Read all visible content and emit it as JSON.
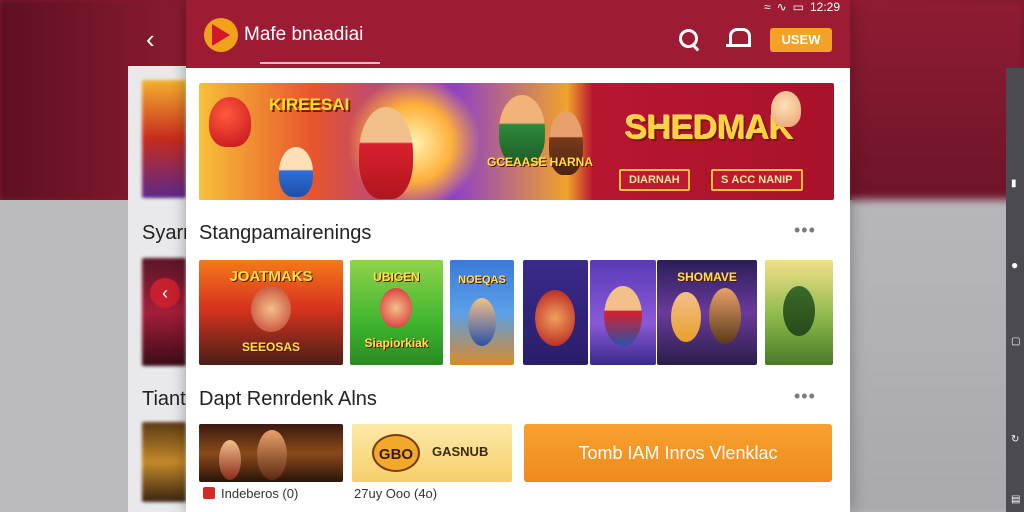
{
  "status_bar": {
    "time": "12:29"
  },
  "header": {
    "app_title": "Mafe bnaadiai",
    "action_button": "USEW"
  },
  "background": {
    "section_one_title": "Syarr",
    "section_two_title": "Tiant"
  },
  "hero": {
    "left_title": "KIREESAI",
    "sub_title": "GCEAASE HARNA",
    "main_title": "SHEDMAK",
    "button_left": "DIARNAH",
    "button_right": "S ACC NANIP"
  },
  "sections": [
    {
      "title": "Stangpamairenings",
      "more_label": "•••",
      "tiles": [
        {
          "label": "JOATMAKS",
          "sub": "SEEOSAS"
        },
        {
          "label": "UBIGEN",
          "sub": "Siapiorkiak"
        },
        {
          "label": "NOEQAS",
          "sub": ""
        },
        {
          "label": "",
          "sub": ""
        },
        {
          "label": "",
          "sub": ""
        },
        {
          "label": "SHOMAVE",
          "sub": ""
        },
        {
          "label": "",
          "sub": ""
        }
      ]
    },
    {
      "title": "Dapt Renrdenk Alns",
      "more_label": "•••",
      "cards": [
        {
          "caption": "Indeberos (0)"
        },
        {
          "badge": "GBO",
          "label": "GASNUB",
          "caption": "27uy Ooo (4o)"
        }
      ],
      "cta_label": "Tomb IAM Inros Vlenklac"
    }
  ]
}
